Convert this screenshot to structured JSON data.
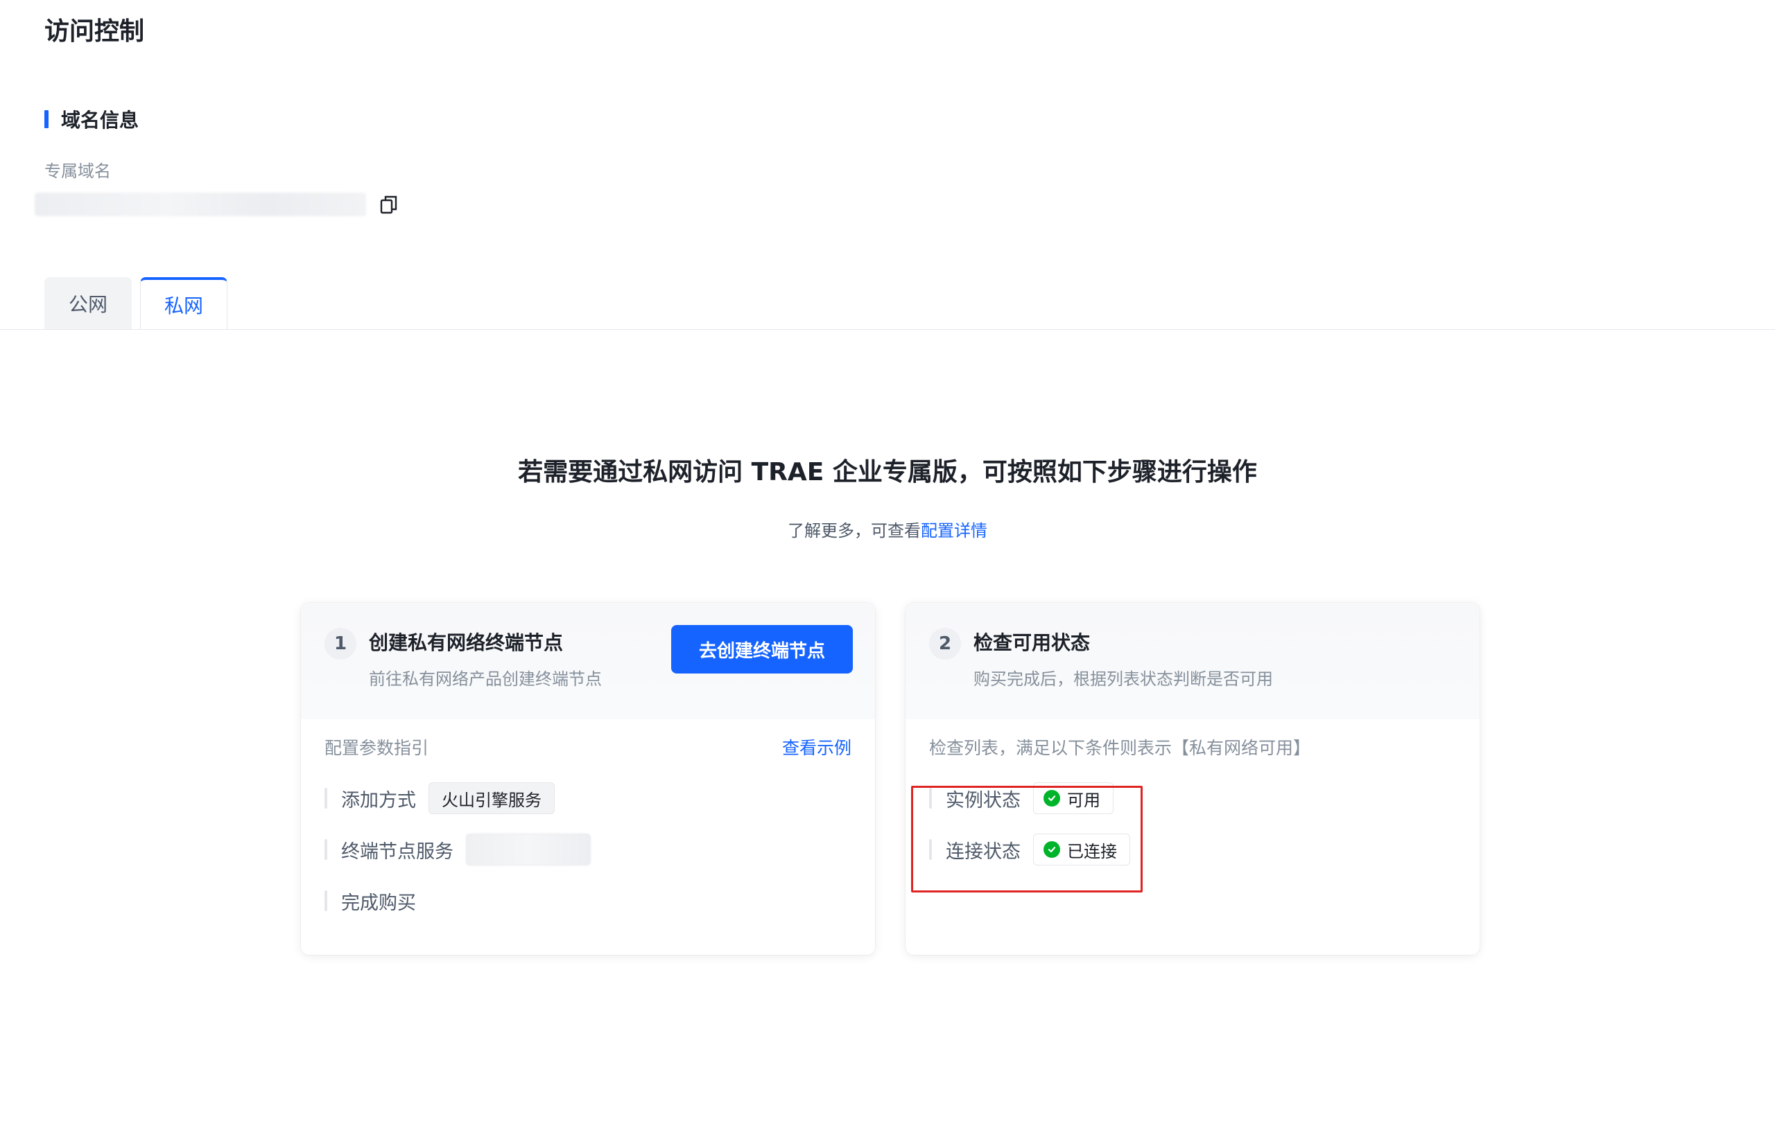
{
  "page": {
    "title": "访问控制"
  },
  "domain_section": {
    "title": "域名信息",
    "field_label": "专属域名",
    "field_value": "",
    "copy_icon": "copy-icon"
  },
  "tabs": [
    {
      "label": "公网",
      "active": false
    },
    {
      "label": "私网",
      "active": true
    }
  ],
  "hero": {
    "title": "若需要通过私网访问 TRAE 企业专属版，可按照如下步骤进行操作",
    "subtitle_prefix": "了解更多，可查看",
    "subtitle_link": "配置详情"
  },
  "step1": {
    "number": "1",
    "title": "创建私有网络终端节点",
    "description": "前往私有网络产品创建终端节点",
    "button_label": "去创建终端节点",
    "body_label": "配置参数指引",
    "example_link": "查看示例",
    "params": [
      {
        "label": "添加方式",
        "value": "火山引擎服务"
      },
      {
        "label": "终端节点服务",
        "value": ""
      },
      {
        "label": "完成购买",
        "value": ""
      }
    ]
  },
  "step2": {
    "number": "2",
    "title": "检查可用状态",
    "description": "购买完成后，根据列表状态判断是否可用",
    "body_label": "检查列表，满足以下条件则表示【私有网络可用】",
    "statuses": [
      {
        "label": "实例状态",
        "value": "可用",
        "icon": "check-circle-icon"
      },
      {
        "label": "连接状态",
        "value": "已连接",
        "icon": "check-circle-icon"
      }
    ]
  },
  "colors": {
    "primary": "#1664ff",
    "success": "#00b42a",
    "highlight": "#e02424"
  }
}
